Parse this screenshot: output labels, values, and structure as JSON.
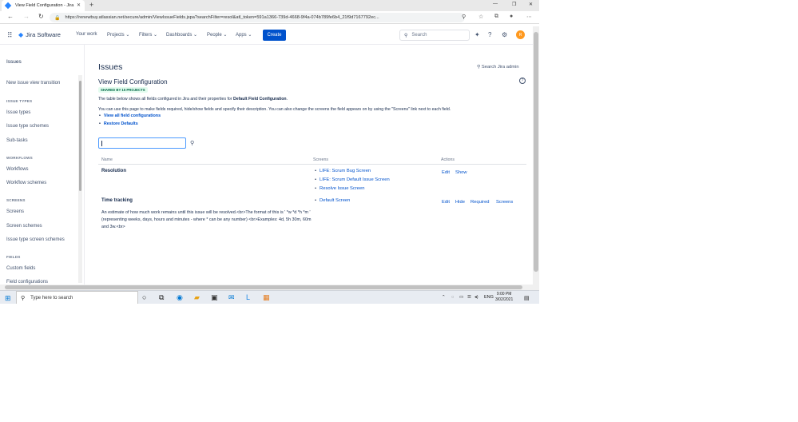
{
  "browser": {
    "tab_title": "View Field Configuration - Jira",
    "url": "https://renewbuy.atlassian.net/secure/admin/ViewIssueFields.jspa?searchFilter=resol&atl_token=591a1366-739d-4668-9f4a-074b789fe6b4_21f9d7167792ec..."
  },
  "header": {
    "product": "Jira Software",
    "nav": [
      "Your work",
      "Projects",
      "Filters",
      "Dashboards",
      "People",
      "Apps"
    ],
    "create_label": "Create",
    "search_placeholder": "Search",
    "avatar_initial": "R"
  },
  "sidebar": {
    "title": "Issues",
    "items": [
      {
        "type": "item",
        "label": "New issue view transition"
      },
      {
        "type": "heading",
        "label": "ISSUE TYPES"
      },
      {
        "type": "item",
        "label": "Issue types"
      },
      {
        "type": "item",
        "label": "Issue type schemes"
      },
      {
        "type": "item",
        "label": "Sub-tasks"
      },
      {
        "type": "heading",
        "label": "WORKFLOWS"
      },
      {
        "type": "item",
        "label": "Workflows"
      },
      {
        "type": "item",
        "label": "Workflow schemes"
      },
      {
        "type": "heading",
        "label": "SCREENS"
      },
      {
        "type": "item",
        "label": "Screens"
      },
      {
        "type": "item",
        "label": "Screen schemes"
      },
      {
        "type": "item",
        "label": "Issue type screen schemes"
      },
      {
        "type": "heading",
        "label": "FIELDS"
      },
      {
        "type": "item",
        "label": "Custom fields"
      },
      {
        "type": "item",
        "label": "Field configurations"
      }
    ]
  },
  "main": {
    "page_title": "Issues",
    "admin_search": "Search Jira admin",
    "config_title": "View Field Configuration",
    "shared_badge": "SHARED BY 15 PROJECTS",
    "desc1_prefix": "The table below shows all fields configured in Jira and their properties for ",
    "desc1_bold": "Default Field Configuration",
    "desc1_suffix": ".",
    "desc2": "You can use this page to make fields required, hide/show fields and specify their description. You can also change the screens the field appears on by using the \"Screens\" link next to each field.",
    "links": [
      "View all field configurations",
      "Restore Defaults"
    ],
    "filter_value": "",
    "columns": {
      "name": "Name",
      "screens": "Screens",
      "actions": "Actions"
    },
    "rows": [
      {
        "name": "Resolution",
        "description": "",
        "screens": [
          "LIFE: Scrum Bug Screen",
          "LIFE: Scrum Default Issue Screen",
          "Resolve Issue Screen"
        ],
        "actions": [
          "Edit",
          "Show"
        ]
      },
      {
        "name": "Time tracking",
        "description": "An estimate of how much work remains until this issue will be resolved.<br>The format of this is ' *w *d *h *m ' (representing weeks, days, hours and minutes - where * can be any number) <br>Examples: 4d, 5h 30m, 60m and 3w.<br>",
        "screens": [
          "Default Screen"
        ],
        "actions": [
          "Edit",
          "Hide",
          "Required",
          "Screens"
        ]
      }
    ]
  },
  "taskbar": {
    "search_placeholder": "Type here to search",
    "language": "ENG",
    "time": "9:00 PM",
    "date": "3/02/2021"
  }
}
